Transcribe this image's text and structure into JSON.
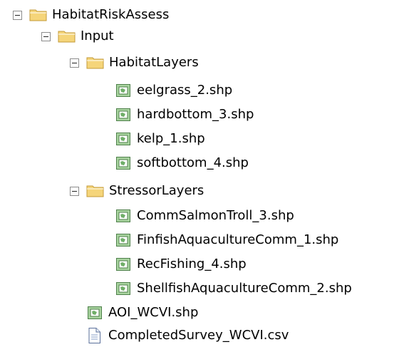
{
  "tree": {
    "root": {
      "label": "HabitatRiskAssess",
      "icon": "folder-icon"
    },
    "input": {
      "label": "Input",
      "icon": "folder-icon"
    },
    "habitat_layers": {
      "label": "HabitatLayers",
      "icon": "folder-icon",
      "files": [
        {
          "label": "eelgrass_2.shp",
          "icon": "shapefile-icon"
        },
        {
          "label": "hardbottom_3.shp",
          "icon": "shapefile-icon"
        },
        {
          "label": "kelp_1.shp",
          "icon": "shapefile-icon"
        },
        {
          "label": "softbottom_4.shp",
          "icon": "shapefile-icon"
        }
      ]
    },
    "stressor_layers": {
      "label": "StressorLayers",
      "icon": "folder-icon",
      "files": [
        {
          "label": "CommSalmonTroll_3.shp",
          "icon": "shapefile-icon"
        },
        {
          "label": "FinfishAquacultureComm_1.shp",
          "icon": "shapefile-icon"
        },
        {
          "label": "RecFishing_4.shp",
          "icon": "shapefile-icon"
        },
        {
          "label": "ShellfishAquacultureComm_2.shp",
          "icon": "shapefile-icon"
        }
      ]
    },
    "input_files": [
      {
        "label": "AOI_WCVI.shp",
        "icon": "shapefile-icon"
      },
      {
        "label": "CompletedSurvey_WCVI.csv",
        "icon": "document-icon"
      }
    ]
  },
  "colors": {
    "folder_fill": "#f5d57a",
    "folder_stroke": "#c39a38",
    "shapefile_fill": "#a9d4a0",
    "shapefile_stroke": "#4d7f49",
    "document_stroke": "#5a6f9a"
  }
}
